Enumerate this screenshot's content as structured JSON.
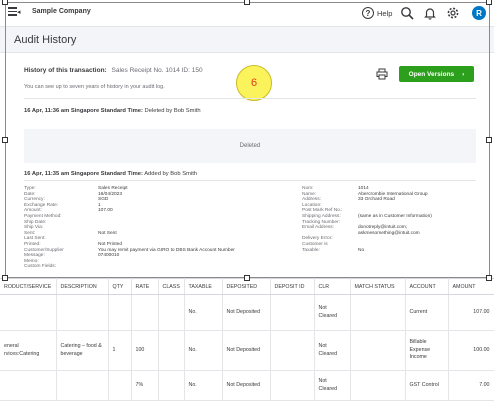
{
  "header": {
    "company_name": "Sample Company",
    "help_label": "Help",
    "help_glyph": "?",
    "avatar_initial": "R",
    "icons": [
      "menu-icon",
      "search-icon",
      "bell-icon",
      "gear-icon"
    ]
  },
  "page": {
    "title": "Audit History"
  },
  "history": {
    "label": "History of this transaction:",
    "transaction": "Sales Receipt No. 1014 ID: 150",
    "note": "You can see up to seven years of history in your audit log.",
    "open_versions_label": "Open Versions",
    "open_versions_arrow": "›",
    "callout_number": "6"
  },
  "entries": {
    "deleted": {
      "timestamp": "16 Apr, 11:36 am Singapore Standard Time:",
      "action": "Deleted by Bob Smith",
      "box_text": "Deleted"
    },
    "added": {
      "timestamp": "16 Apr, 11:35 am Singapore Standard Time:",
      "action": "Added by Bob Smith"
    }
  },
  "details_left": [
    {
      "key": "Type:",
      "value": "Sales Receipt"
    },
    {
      "key": "Date:",
      "value": "16/04/2023"
    },
    {
      "key": "Currency:",
      "value": "SGD"
    },
    {
      "key": "Exchange Rate:",
      "value": "1"
    },
    {
      "key": "Amount:",
      "value": "107.00"
    },
    {
      "key": "Payment Method:",
      "value": ""
    },
    {
      "key": "Ship Date:",
      "value": ""
    },
    {
      "key": "Ship Via:",
      "value": ""
    },
    {
      "key": "Sent:",
      "value": "Not Sent"
    },
    {
      "key": "Last Sent:",
      "value": ""
    },
    {
      "key": "Printed:",
      "value": "Not Printed"
    },
    {
      "key": "Customer/Supplier",
      "value": "You may remit payment via GIRO to DBS Bank Account Number"
    },
    {
      "key": "Message:",
      "value": "07400010"
    },
    {
      "key": "Memo:",
      "value": ""
    },
    {
      "key": "Custom Fields:",
      "value": ""
    }
  ],
  "details_right": [
    {
      "key": "Num:",
      "value": "1014"
    },
    {
      "key": "Name:",
      "value": "Abercrombie International Group"
    },
    {
      "key": "Address:",
      "value": "33 Orchard Road"
    },
    {
      "key": "Location:",
      "value": ""
    },
    {
      "key": "Post Mark Ref No.:",
      "value": ""
    },
    {
      "key": "Shipping Address:",
      "value": "(same as in Customer Information)"
    },
    {
      "key": "Tracking Number:",
      "value": ""
    },
    {
      "key": "Email Address:",
      "value": "donotreply@intuit.com;"
    },
    {
      "key": "",
      "value": "askmesomething@intuit.com"
    },
    {
      "key": "Delivery Error:",
      "value": ""
    },
    {
      "key": "Customer is",
      "value": ""
    },
    {
      "key": "Taxable:",
      "value": "No"
    }
  ],
  "table": {
    "columns": [
      "RODUCT/SERVICE",
      "DESCRIPTION",
      "QTY",
      "RATE",
      "CLASS",
      "TAXABLE",
      "DEPOSITED",
      "DEPOSIT ID",
      "CLR",
      "MATCH STATUS",
      "ACCOUNT",
      "AMOUNT"
    ],
    "rows": [
      [
        "",
        "",
        "",
        "",
        "",
        "No.",
        "Not Deposited",
        "",
        "Not Cleared",
        "",
        "Current",
        "107.00"
      ],
      [
        "eneral rvices:Catering",
        "Catering – food & beverage",
        "1",
        "100",
        "",
        "No.",
        "Not Deposited",
        "",
        "Not Cleared",
        "",
        "Billable Expense Income",
        "100.00"
      ],
      [
        "",
        "",
        "",
        "7%",
        "",
        "No.",
        "Not Deposited",
        "",
        "Not Cleared",
        "",
        "GST Control",
        "7.00"
      ]
    ]
  },
  "colors": {
    "accent_green": "#2ca01c",
    "avatar_blue": "#0077c5",
    "callout_yellow": "#fbf35b",
    "callout_text": "#e53c1d"
  }
}
